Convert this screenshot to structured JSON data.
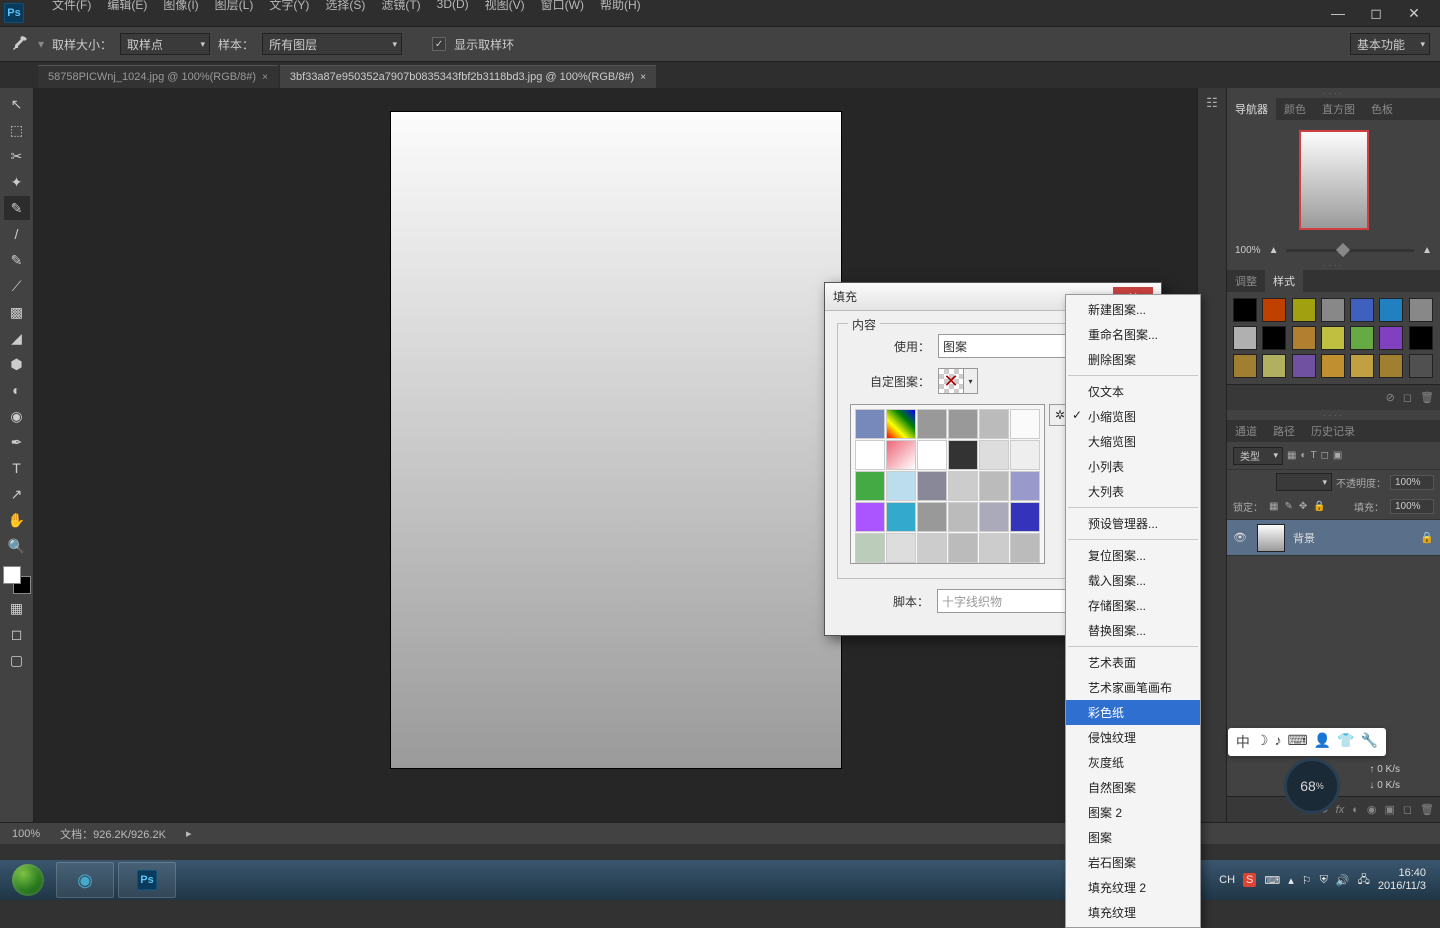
{
  "app": {
    "logo": "Ps"
  },
  "menu": [
    "文件(F)",
    "编辑(E)",
    "图像(I)",
    "图层(L)",
    "文字(Y)",
    "选择(S)",
    "滤镜(T)",
    "3D(D)",
    "视图(V)",
    "窗口(W)",
    "帮助(H)"
  ],
  "options": {
    "sampleSizeLabel": "取样大小：",
    "sampleSizeValue": "取样点",
    "sampleLabel": "样本：",
    "sampleValue": "所有图层",
    "showRingLabel": "显示取样环",
    "basicFunc": "基本功能"
  },
  "tabs": [
    {
      "name": "58758PICWnj_1024.jpg @ 100%(RGB/8#)",
      "active": false
    },
    {
      "name": "3bf33a87e950352a7907b0835343fbf2b3118bd3.jpg @ 100%(RGB/8#)",
      "active": true
    }
  ],
  "statusbar": {
    "zoom": "100%",
    "doc": "文档：926.2K/926.2K"
  },
  "fillDialog": {
    "title": "填充",
    "contentGroup": "内容",
    "useLabel": "使用：",
    "useValue": "图案",
    "customPatternLabel": "自定图案：",
    "scriptLabel": "脚本：",
    "scriptValue": "十字线织物"
  },
  "contextMenu": {
    "items": [
      "新建图案...",
      "重命名图案...",
      "删除图案",
      "-",
      "仅文本",
      "小缩览图",
      "大缩览图",
      "小列表",
      "大列表",
      "-",
      "预设管理器...",
      "-",
      "复位图案...",
      "载入图案...",
      "存储图案...",
      "替换图案...",
      "-",
      "艺术表面",
      "艺术家画笔画布",
      "彩色纸",
      "侵蚀纹理",
      "灰度纸",
      "自然图案",
      "图案 2",
      "图案",
      "岩石图案",
      "填充纹理 2",
      "填充纹理"
    ],
    "checked": "小缩览图",
    "highlight": "彩色纸"
  },
  "panels": {
    "navTabs": [
      "导航器",
      "颜色",
      "直方图",
      "色板"
    ],
    "navZoom": "100%",
    "adjustTabs": [
      "调整",
      "样式"
    ],
    "styleColors": [
      "#000",
      "#c04000",
      "#a0a010",
      "#888",
      "#4060c0",
      "#2080c0",
      "#888",
      "#b0b0b0",
      "#000",
      "#b08030",
      "#c0c040",
      "#6a4",
      "#8040c0",
      "#000",
      "#a08030",
      "#b0b060",
      "#7050a0",
      "#c09030",
      "#c0a040",
      "#a08030",
      "#505050"
    ],
    "layerTabs": [
      "通道",
      "路径",
      "历史记录"
    ],
    "layerKind": "类型",
    "opacityLabel": "不透明度：",
    "opacityValue": "100%",
    "lockLabel": "锁定：",
    "fillLabel": "填充：",
    "fillValue": "100%",
    "bgLayer": "背景"
  },
  "tray": {
    "lang": "CH",
    "time": "16:40",
    "date": "2016/11/3",
    "cpu": "68"
  },
  "floatIcons": [
    "中",
    "☽",
    "♪",
    "⌨",
    "👤",
    "👕",
    "🔧"
  ],
  "netUp": "0 K/s",
  "netDn": "0 K/s",
  "patternColors": [
    "#7788bb",
    "linear-gradient(45deg,red,yellow,green,blue)",
    "#999",
    "#999",
    "#bbb",
    "#fafafa",
    "#fff",
    "linear-gradient(135deg,#e67,#fff)",
    "#fff",
    "#333",
    "#ddd",
    "#eee",
    "#4a4",
    "#bde",
    "#889",
    "#ccc",
    "#bbb",
    "#99c",
    "#a5f",
    "#3ac",
    "#999",
    "#bbb",
    "#aab",
    "#33b",
    "#bcb",
    "#ddd",
    "#ccc",
    "#bbb",
    "#ccc",
    "#bbb"
  ]
}
